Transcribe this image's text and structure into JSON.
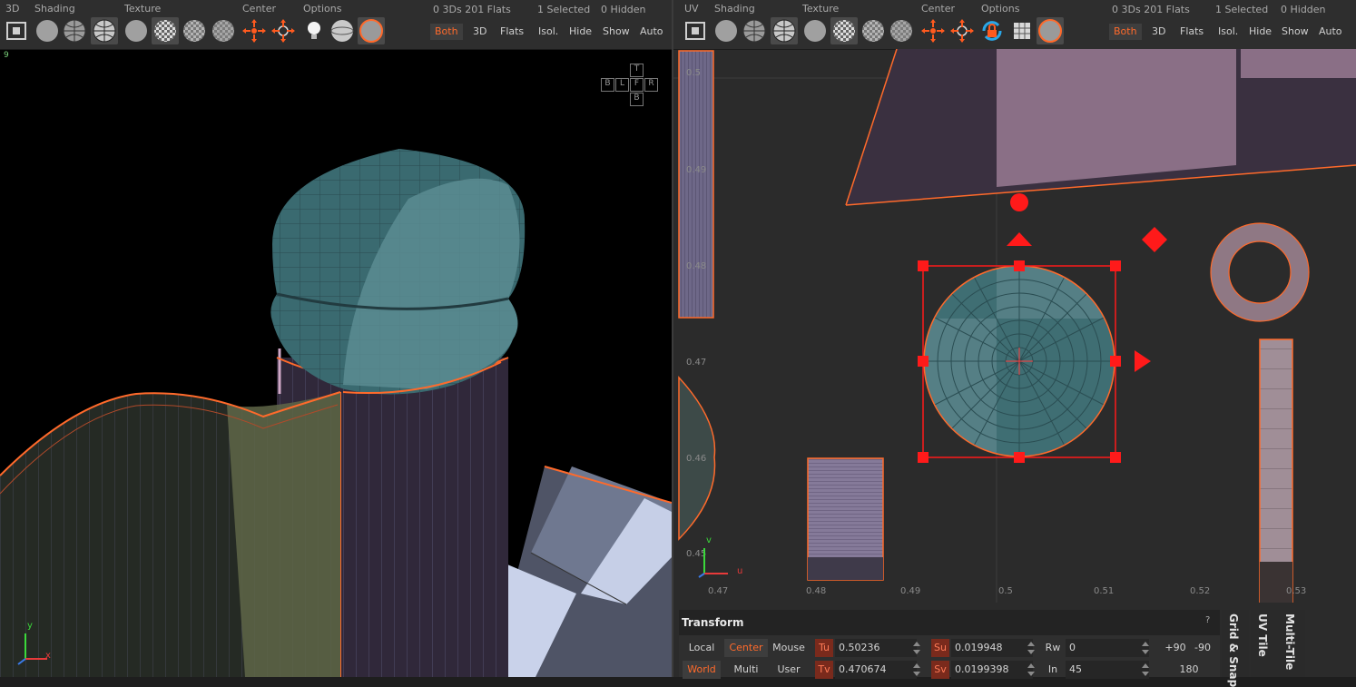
{
  "left_toolbar": {
    "sections": [
      "3D",
      "Shading",
      "Texture",
      "Center",
      "Options"
    ],
    "stats": [
      "0 3Ds 201 Flats",
      "1 Selected",
      "0 Hidden"
    ],
    "filters": [
      "Both",
      "3D",
      "Flats"
    ],
    "actions": [
      "Isol.",
      "Hide",
      "Show",
      "Auto"
    ],
    "active_filter": "Both"
  },
  "right_toolbar": {
    "sections": [
      "UV",
      "Shading",
      "Texture",
      "Center",
      "Options"
    ],
    "stats": [
      "0 3Ds 201 Flats",
      "1 Selected",
      "0 Hidden"
    ],
    "filters": [
      "Both",
      "3D",
      "Flats"
    ],
    "actions": [
      "Isol.",
      "Hide",
      "Show",
      "Auto"
    ],
    "active_filter": "Both"
  },
  "viewport_3d": {
    "corner_label": "9",
    "navcube": [
      "T",
      "B",
      "L",
      "F",
      "R",
      "B"
    ],
    "axis_labels": [
      "y",
      "x"
    ]
  },
  "viewport_uv": {
    "corner_label": "3 I",
    "axis_labels": [
      "v",
      "u"
    ],
    "u_ticks": [
      "0.47",
      "0.48",
      "0.49",
      "0.5",
      "0.51",
      "0.52",
      "0.53"
    ],
    "v_ticks": [
      "0.5",
      "0.49",
      "0.48",
      "0.47",
      "0.46",
      "0.45"
    ]
  },
  "transform_panel": {
    "title": "Transform",
    "help": "?",
    "space_options": [
      "Local",
      "World"
    ],
    "pivot_options": [
      "Center",
      "Multi"
    ],
    "input_options": [
      "Mouse",
      "User"
    ],
    "tu_label": "Tu",
    "tu_value": "0.50236",
    "tv_label": "Tv",
    "tv_value": "0.470674",
    "su_label": "Su",
    "su_value": "0.019948",
    "sv_label": "Sv",
    "sv_value": "0.0199398",
    "rw_label": "Rw",
    "rw_value": "0",
    "in_label": "In",
    "in_value": "45",
    "rotate_presets": [
      "+90",
      "-90",
      "180"
    ]
  },
  "side_tabs": [
    "Grid & Snap",
    "UV Tile",
    "Multi-Tile"
  ],
  "colors": {
    "accent": "#ff6a2b",
    "selection": "#ff1a1a",
    "uv_shell_pink": "#8a6f86",
    "mesh_teal": "#3f6e73"
  }
}
